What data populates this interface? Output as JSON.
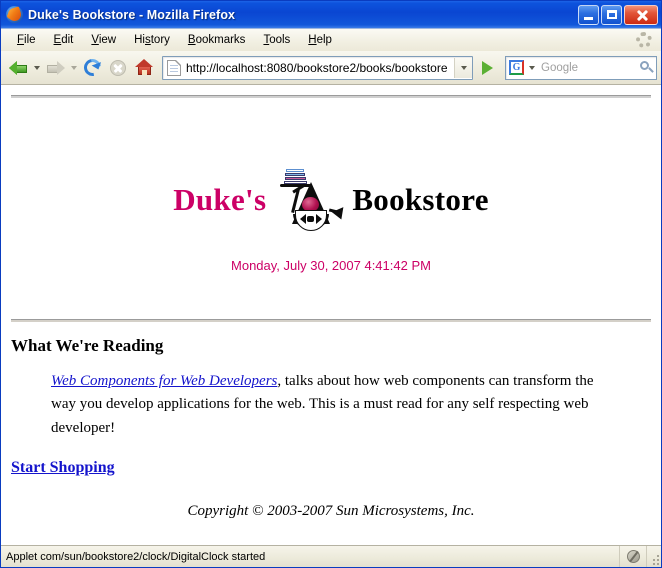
{
  "window": {
    "title": "Duke's Bookstore - Mozilla Firefox",
    "app_icon": "firefox-icon",
    "controls": {
      "minimize": "minimize-button",
      "maximize": "maximize-button",
      "close": "close-button"
    }
  },
  "menubar": {
    "items": [
      {
        "label": "File",
        "accel": "F"
      },
      {
        "label": "Edit",
        "accel": "E"
      },
      {
        "label": "View",
        "accel": "V"
      },
      {
        "label": "History",
        "accel": "s"
      },
      {
        "label": "Bookmarks",
        "accel": "B"
      },
      {
        "label": "Tools",
        "accel": "T"
      },
      {
        "label": "Help",
        "accel": "H"
      }
    ],
    "throbber": "activity-indicator-icon"
  },
  "toolbar": {
    "back": "back-arrow-icon",
    "forward": "forward-arrow-icon",
    "reload": "reload-icon",
    "stop": "stop-icon",
    "home": "home-icon",
    "url_value": "http://localhost:8080/bookstore2/books/bookstore",
    "url_placeholder": "",
    "go": "go-icon",
    "search_engine": "G",
    "search_placeholder": "Google",
    "search_value": "",
    "search_icon": "magnifier-icon"
  },
  "page": {
    "brand_first": "Duke's",
    "brand_second": "Bookstore",
    "mascot": "duke-mascot-icon",
    "datestamp": "Monday, July 30, 2007 4:41:42 PM",
    "heading": "What We're Reading",
    "feature_link": "Web Components for Web Developers",
    "feature_text": ", talks about how web components can transform the way you develop applications for the web. This is a must read for any self respecting web developer!",
    "start_shopping": "Start Shopping",
    "copyright": "Copyright © 2003-2007 Sun Microsystems, Inc."
  },
  "statusbar": {
    "message": "Applet com/sun/bookstore2/clock/DigitalClock started",
    "proxy_icon": "no-proxy-icon",
    "resize_grip": "resize-grip"
  },
  "colors": {
    "brand_pink": "#cc0066",
    "link_blue": "#1414cc",
    "titlebar_blue": "#0a46d2",
    "chrome_beige": "#ece9d8"
  }
}
